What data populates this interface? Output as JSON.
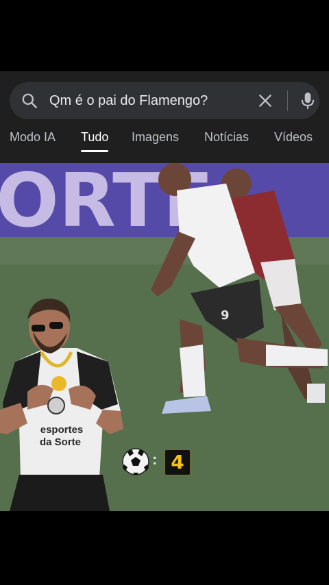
{
  "search": {
    "query": "Qm é o pai do Flamengo?",
    "search_icon": "search-icon",
    "clear_icon": "close-icon",
    "mic_icon": "microphone-icon"
  },
  "tabs": [
    {
      "label": "Modo IA",
      "active": false
    },
    {
      "label": "Tudo",
      "active": true
    },
    {
      "label": "Imagens",
      "active": false
    },
    {
      "label": "Notícias",
      "active": false
    },
    {
      "label": "Vídeos",
      "active": false
    }
  ],
  "video": {
    "banner_text": "ORTE",
    "player_number": "9",
    "sponsor_text_line1": "esportes",
    "sponsor_text_line2": "da Sorte",
    "goal_counter": {
      "icon": "soccer-ball-icon",
      "separator": ":",
      "value": "4"
    }
  },
  "colors": {
    "panel_bg": "#1f1f1f",
    "search_bg": "#303134",
    "goal_number": "#f2c318"
  }
}
